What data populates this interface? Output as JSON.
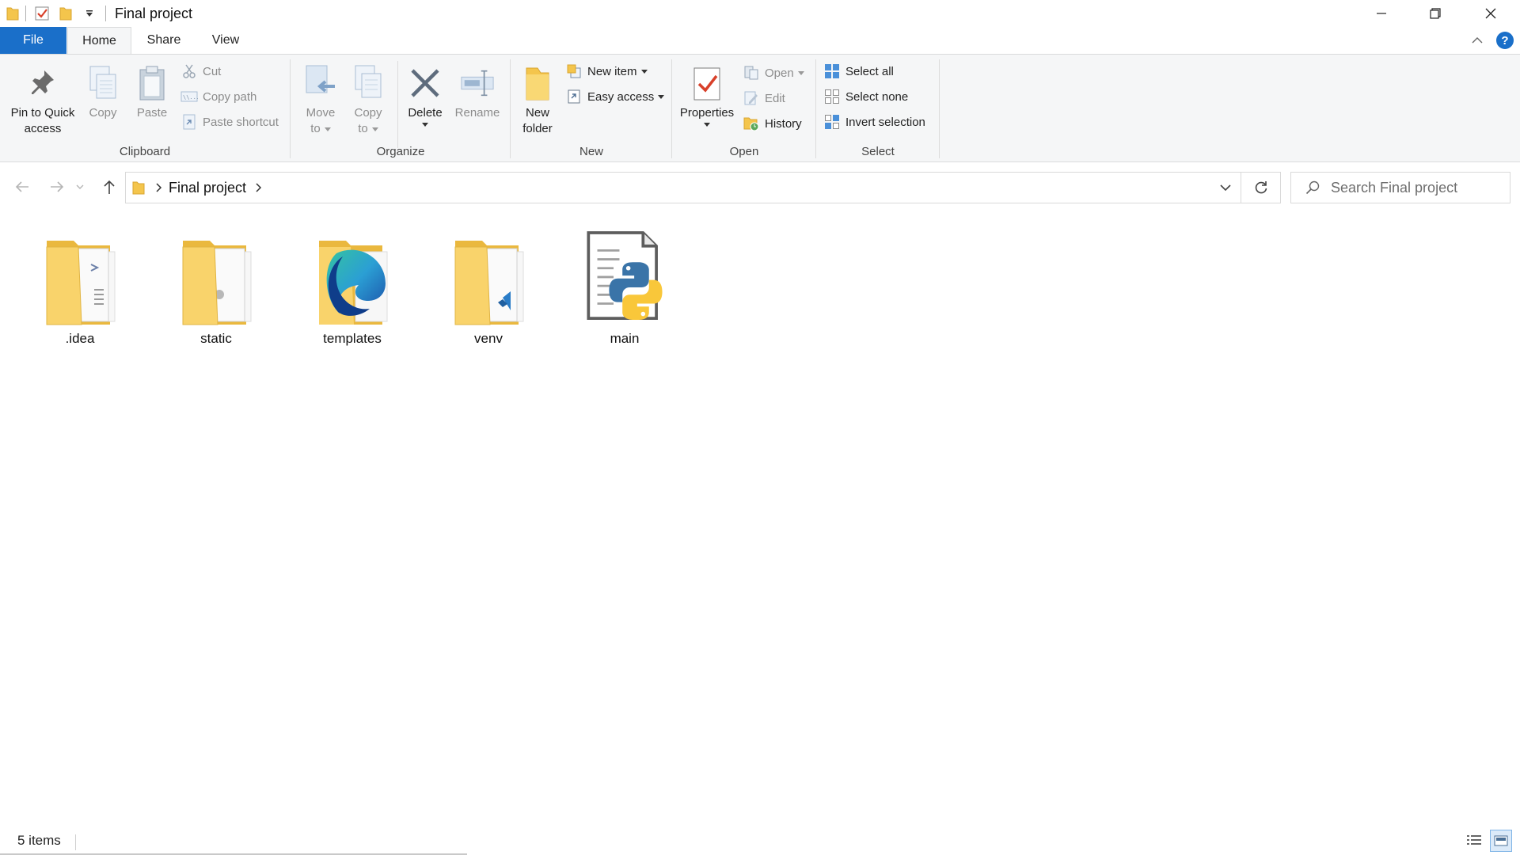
{
  "window": {
    "title": "Final project"
  },
  "tabs": {
    "file": "File",
    "home": "Home",
    "share": "Share",
    "view": "View"
  },
  "ribbon": {
    "clipboard": {
      "label": "Clipboard",
      "pin_line1": "Pin to Quick",
      "pin_line2": "access",
      "copy": "Copy",
      "paste": "Paste",
      "cut": "Cut",
      "copy_path": "Copy path",
      "paste_shortcut": "Paste shortcut"
    },
    "organize": {
      "label": "Organize",
      "move_line1": "Move",
      "move_line2": "to",
      "copy_line1": "Copy",
      "copy_line2": "to",
      "delete": "Delete",
      "rename": "Rename"
    },
    "new": {
      "label": "New",
      "folder_line1": "New",
      "folder_line2": "folder",
      "new_item": "New item",
      "easy_access": "Easy access"
    },
    "open": {
      "label": "Open",
      "properties": "Properties",
      "open": "Open",
      "edit": "Edit",
      "history": "History"
    },
    "select": {
      "label": "Select",
      "select_all": "Select all",
      "select_none": "Select none",
      "invert_selection": "Invert selection"
    }
  },
  "address": {
    "crumb": "Final project",
    "search_placeholder": "Search Final project"
  },
  "items": [
    {
      "name": ".idea",
      "type": "folder"
    },
    {
      "name": "static",
      "type": "folder"
    },
    {
      "name": "templates",
      "type": "folder"
    },
    {
      "name": "venv",
      "type": "folder"
    },
    {
      "name": "main",
      "type": "python-file"
    }
  ],
  "status": {
    "count": "5 items"
  },
  "colors": {
    "accent": "#1a6fc9",
    "folder": "#f4c54c",
    "python_blue": "#3a74a8",
    "python_yellow": "#f9c73a"
  }
}
